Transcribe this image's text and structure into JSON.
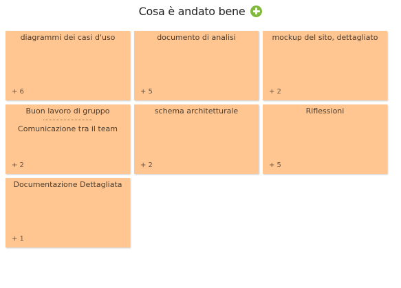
{
  "header": {
    "title": "Cosa è andato bene",
    "add_icon": "plus-circle-icon",
    "add_color": "#7fba3c"
  },
  "card_color": "#ffc691",
  "cards": [
    {
      "title": "diagrammi dei casi d'uso",
      "votes": "+ 6"
    },
    {
      "title": "documento di analisi",
      "votes": "+ 5"
    },
    {
      "title": "mockup del sito, dettagliato",
      "votes": "+ 2"
    },
    {
      "title": "Buon lavoro di gruppo",
      "subtitle": "Comunicazione tra il team",
      "votes": "+ 2"
    },
    {
      "title": "schema architetturale",
      "votes": "+ 2"
    },
    {
      "title": "Riflessioni",
      "votes": "+ 5"
    },
    {
      "title": "Documentazione Dettagliata",
      "votes": "+ 1"
    }
  ]
}
